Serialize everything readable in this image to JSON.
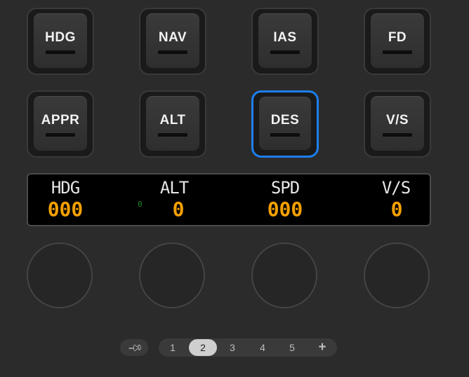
{
  "keys": [
    {
      "label": "HDG"
    },
    {
      "label": "NAV"
    },
    {
      "label": "IAS"
    },
    {
      "label": "FD"
    },
    {
      "label": "APPR"
    },
    {
      "label": "ALT"
    },
    {
      "label": "DES",
      "selected": true
    },
    {
      "label": "V/S"
    }
  ],
  "display": {
    "fields": [
      {
        "label": "HDG",
        "value": "000"
      },
      {
        "label": "ALT",
        "value": "0"
      },
      {
        "label": "SPD",
        "value": "000"
      },
      {
        "label": "V/S",
        "value": "0"
      }
    ],
    "small_value": "0"
  },
  "pager": {
    "pages": [
      "1",
      "2",
      "3",
      "4",
      "5"
    ],
    "active_page": "2",
    "add_label": "+"
  },
  "icons": {
    "pin": "pin-icon",
    "add": "plus-icon"
  },
  "colors": {
    "selection": "#1e7ff0",
    "display_digits": "#f5a000",
    "display_small": "#1f8a2a"
  }
}
